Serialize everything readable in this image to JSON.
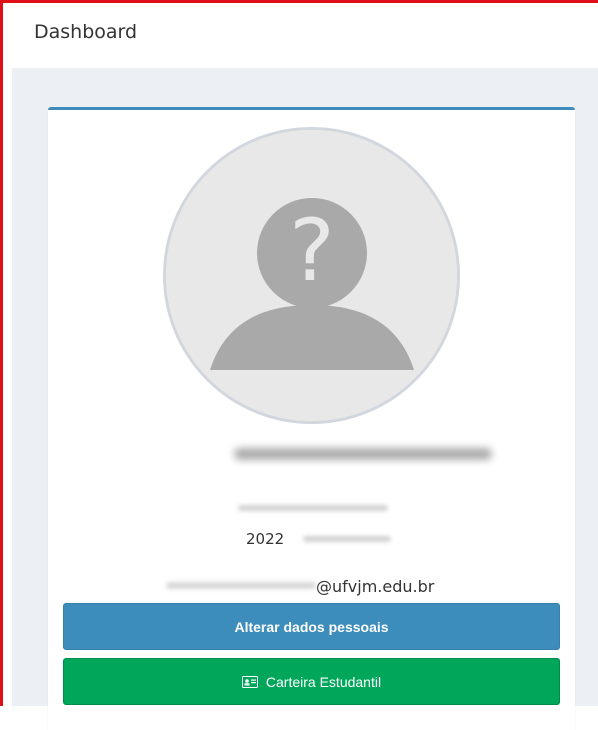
{
  "header": {
    "title": "Dashboard"
  },
  "profile": {
    "year_prefix": "2022",
    "email_suffix": "@ufvjm.edu.br"
  },
  "buttons": {
    "edit_label": "Alterar dados pessoais",
    "card_label": "Carteira Estudantil",
    "card_icon": "id-card-icon"
  },
  "colors": {
    "frame": "#e0101b",
    "primary": "#3c8dbc",
    "success": "#00a65a"
  }
}
